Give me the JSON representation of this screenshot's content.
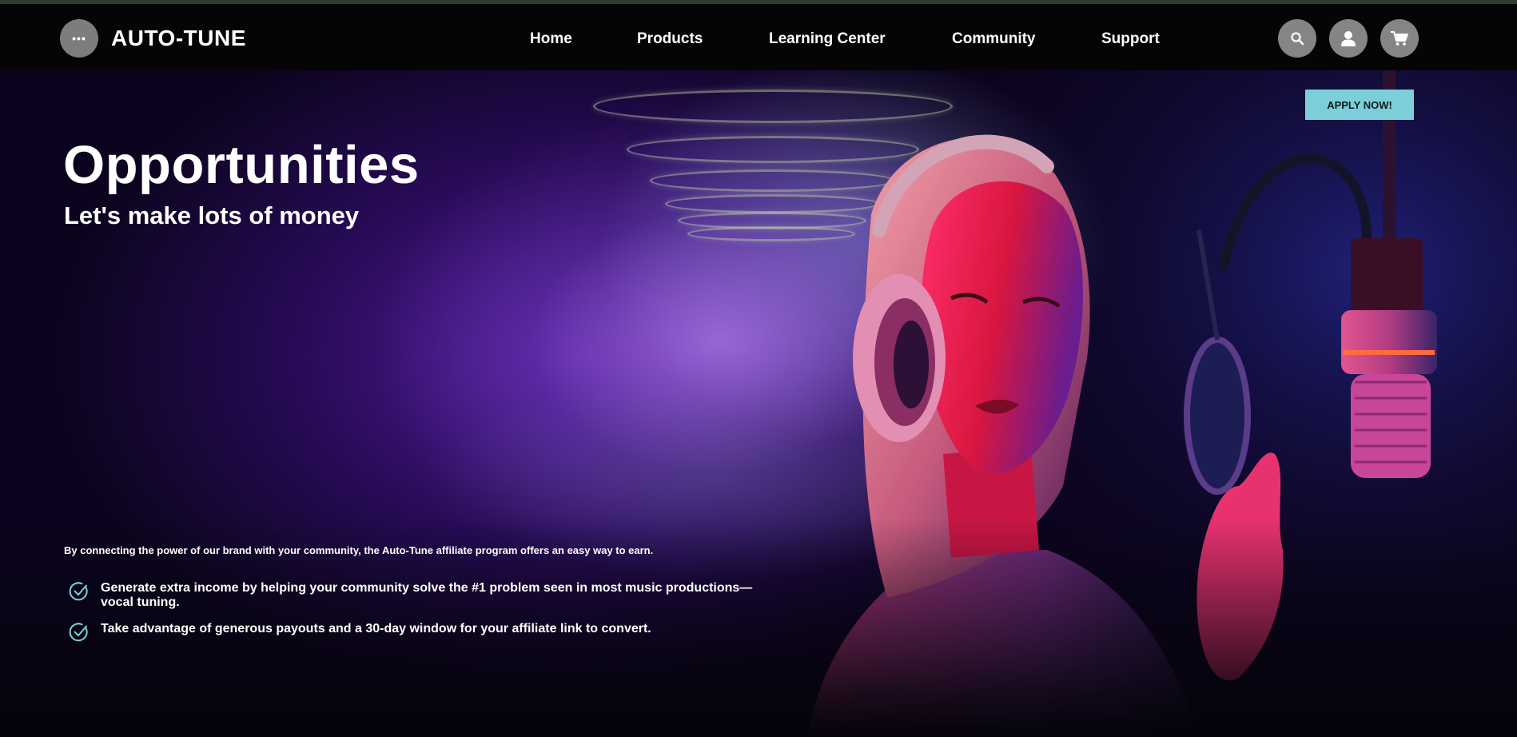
{
  "header": {
    "menu_label": "•••",
    "brand": "AUTO-TUNE",
    "nav": [
      "Home",
      "Products",
      "Learning Center",
      "Community",
      "Support"
    ],
    "icons": [
      "search-icon",
      "user-icon",
      "cart-icon"
    ]
  },
  "hero": {
    "title": "Opportunities",
    "subtitle": "Let's make lots of money",
    "cta": "APPLY NOW!",
    "intro": "By connecting the power of our brand with your community, the Auto-Tune affiliate program offers an easy way to earn.",
    "bullets": [
      "Generate extra income by helping your community solve the #1 problem seen in most music productions—vocal tuning.",
      "Take advantage of generous payouts and a 30-day window for your affiliate link to convert."
    ]
  },
  "colors": {
    "accent": "#7ccfd9",
    "nav_bg": "#050505",
    "button_gray": "#858585"
  }
}
